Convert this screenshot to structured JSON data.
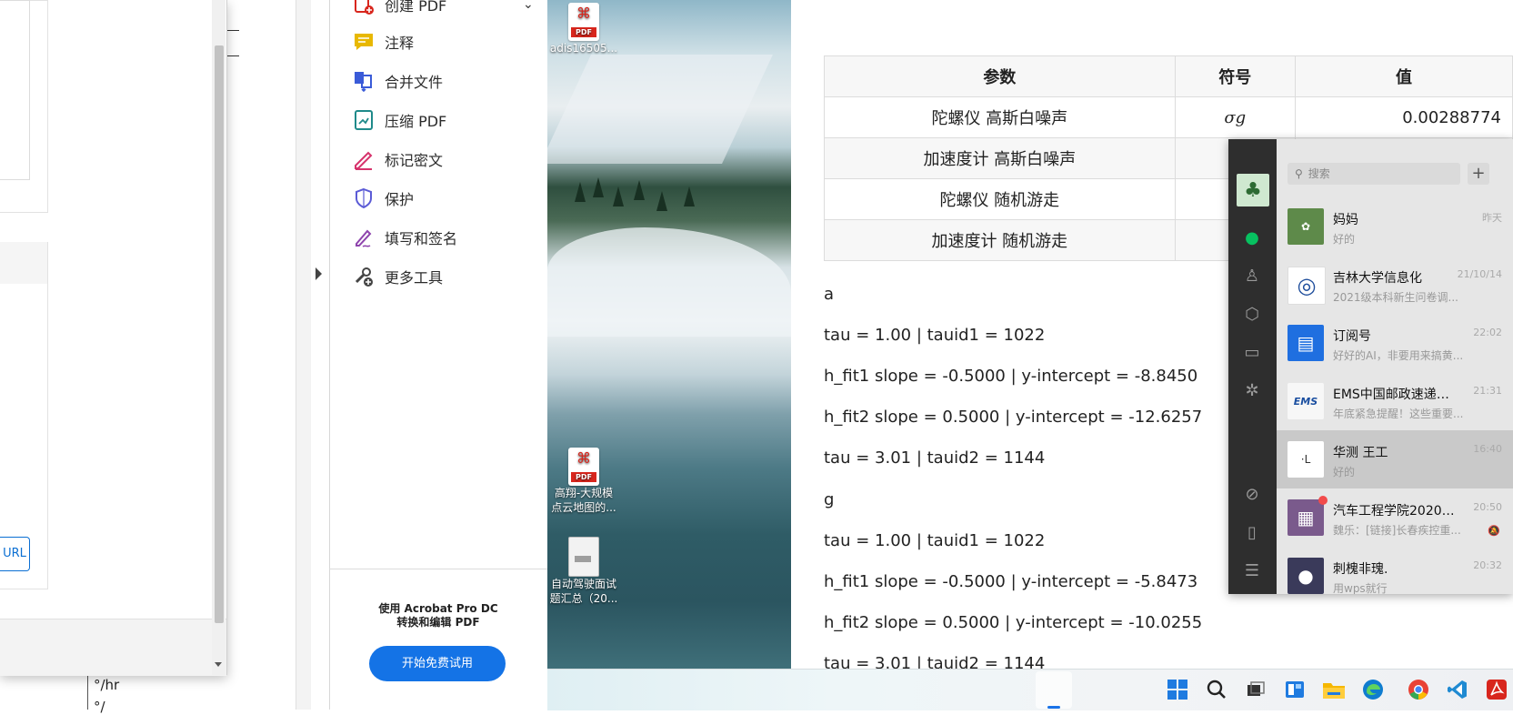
{
  "dialog": {
    "url_button": "URL",
    "behind_text_1": "°/hr",
    "behind_text_2": "°/"
  },
  "tools": {
    "items": [
      {
        "label": "创建 PDF",
        "icon": "create-pdf-icon"
      },
      {
        "label": "注释",
        "icon": "comment-icon"
      },
      {
        "label": "合并文件",
        "icon": "combine-files-icon"
      },
      {
        "label": "压缩 PDF",
        "icon": "compress-pdf-icon"
      },
      {
        "label": "标记密文",
        "icon": "redact-icon"
      },
      {
        "label": "保护",
        "icon": "shield-icon"
      },
      {
        "label": "填写和签名",
        "icon": "fill-sign-icon"
      },
      {
        "label": "更多工具",
        "icon": "more-tools-icon"
      }
    ],
    "promo_line1": "使用 Acrobat Pro DC",
    "promo_line2": "转换和编辑 PDF",
    "trial_button": "开始免费试用"
  },
  "desktop": {
    "icons": [
      {
        "label": "adis16505...",
        "type": "pdf"
      },
      {
        "label": "高翔-大规模",
        "label2": "点云地图的...",
        "type": "pdf"
      },
      {
        "label": "自动驾驶面试",
        "label2": "题汇总（20...",
        "type": "doc"
      }
    ],
    "pdf_badge": "PDF"
  },
  "document": {
    "table": {
      "headers": [
        "参数",
        "符号",
        "值"
      ],
      "rows": [
        [
          "陀螺仪 高斯白噪声",
          "σg",
          "0.00288774"
        ],
        [
          "加速度计 高斯白噪声",
          "",
          ""
        ],
        [
          "陀螺仪 随机游走",
          "",
          ""
        ],
        [
          "加速度计 随机游走",
          "",
          ""
        ]
      ]
    },
    "lines": [
      "a",
      "tau = 1.00 | tauid1 = 1022",
      "h_fit1 slope = -0.5000 | y-intercept = -8.8450",
      "h_fit2 slope = 0.5000 | y-intercept = -12.6257",
      "tau = 3.01 | tauid2 = 1144",
      "g",
      "tau = 1.00 | tauid1 = 1022",
      "h_fit1 slope = -0.5000 | y-intercept = -5.8473",
      "h_fit2 slope = 0.5000 | y-intercept = -10.0255",
      "tau = 3.01 | tauid2 = 1144"
    ]
  },
  "chat": {
    "search_placeholder": "搜索",
    "plus": "+",
    "conversations": [
      {
        "name": "妈妈",
        "preview": "好的",
        "time": "昨天",
        "avatar_color": "#4a7a3a",
        "avatar_text": "✿"
      },
      {
        "name": "吉林大学信息化",
        "preview": "2021级本科新生问卷调...",
        "time": "21/10/14",
        "avatar_color": "#ffffff",
        "avatar_text": "◎"
      },
      {
        "name": "订阅号",
        "preview": "好好的AI，非要用来搞黄...",
        "time": "22:02",
        "avatar_color": "#1f6fe0",
        "avatar_text": "▤"
      },
      {
        "name": "EMS中国邮政速递物...",
        "preview": "年底紧急提醒！这些重要...",
        "time": "21:31",
        "avatar_color": "#f7f7f7",
        "avatar_text": "EMS"
      },
      {
        "name": "华测 王工",
        "preview": "好的",
        "time": "16:40",
        "avatar_color": "#ffffff",
        "avatar_text": "·L"
      },
      {
        "name": "汽车工程学院2020级...",
        "preview": "魏乐：[链接]长春疾控重...",
        "time": "20:50",
        "avatar_color": "#7a5a8c",
        "avatar_text": "▦"
      },
      {
        "name": "刺槐非瑰.",
        "preview": "用wps就行",
        "time": "20:32",
        "avatar_color": "#3a3a5a",
        "avatar_text": "●"
      }
    ]
  },
  "colors": {
    "acrobat_blue": "#1473e6",
    "wechat_green": "#07c160",
    "pdf_red": "#d8261d"
  }
}
